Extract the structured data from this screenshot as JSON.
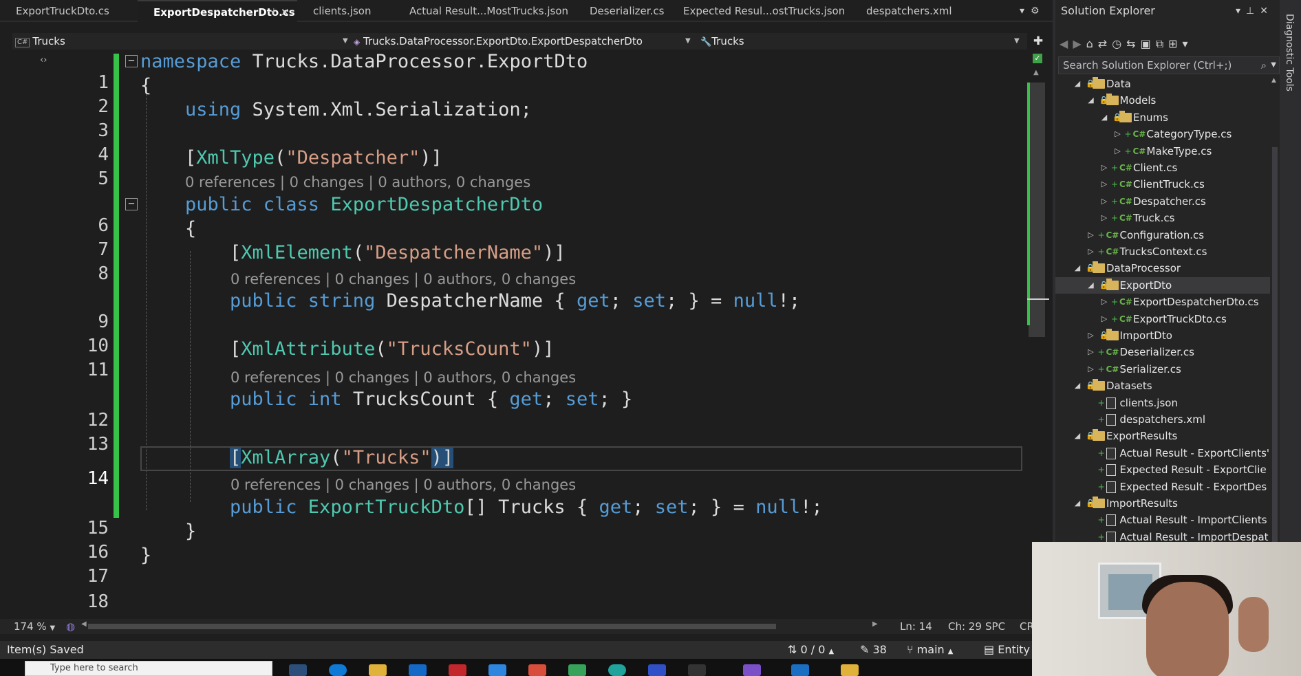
{
  "tabs": [
    {
      "label": "ExportTruckDto.cs",
      "active": false
    },
    {
      "label": "ExportDespatcherDto.cs",
      "active": true
    },
    {
      "label": "clients.json",
      "active": false
    },
    {
      "label": "Actual Result...MostTrucks.json",
      "active": false
    },
    {
      "label": "Deserializer.cs",
      "active": false
    },
    {
      "label": "Expected Resul...ostTrucks.json",
      "active": false
    },
    {
      "label": "despatchers.xml",
      "active": false
    }
  ],
  "navbar": {
    "project": "Trucks",
    "type": "Trucks.DataProcessor.ExportDto.ExportDespatcherDto",
    "member": "Trucks"
  },
  "editor": {
    "line_numbers": [
      "1",
      "2",
      "3",
      "4",
      "5",
      "6",
      "7",
      "8",
      "9",
      "10",
      "11",
      "12",
      "13",
      "14",
      "15",
      "16",
      "17",
      "18"
    ],
    "current_line": "14",
    "codelens": "0 references | 0 changes | 0 authors, 0 changes",
    "code": {
      "l1_kw": "namespace",
      "l1_name": " Trucks.DataProcessor.ExportDto",
      "l2": "{",
      "l3_kw": "using",
      "l3_rest": " System.Xml.Serialization;",
      "l5_open": "[",
      "l5_attr": "XmlType",
      "l5_p1": "(",
      "l5_str": "\"Despatcher\"",
      "l5_close": ")]",
      "l6_kw": "public class",
      "l6_type": " ExportDespatcherDto",
      "l7": "{",
      "l8_open": "[",
      "l8_attr": "XmlElement",
      "l8_p1": "(",
      "l8_str": "\"DespatcherName\"",
      "l8_close": ")]",
      "l9_kw": "public string",
      "l9_name": " DespatcherName { ",
      "l9_get": "get",
      "l9_s1": "; ",
      "l9_set": "set",
      "l9_s2": "; } = ",
      "l9_null": "null",
      "l9_end": "!;",
      "l11_open": "[",
      "l11_attr": "XmlAttribute",
      "l11_p1": "(",
      "l11_str": "\"TrucksCount\"",
      "l11_close": ")]",
      "l12_kw": "public int",
      "l12_name": " TrucksCount { ",
      "l12_get": "get",
      "l12_s1": "; ",
      "l12_set": "set",
      "l12_end": "; }",
      "l14_open": "[",
      "l14_attr": "XmlArray",
      "l14_p1": "(",
      "l14_str": "\"Trucks\"",
      "l14_close": ")]",
      "l15_kw": "public",
      "l15_type": " ExportTruckDto",
      "l15_mid": "[] Trucks { ",
      "l15_get": "get",
      "l15_s1": "; ",
      "l15_set": "set",
      "l15_s2": "; } = ",
      "l15_null": "null",
      "l15_end": "!;",
      "l16": "}",
      "l17": "}"
    }
  },
  "editor_status": {
    "zoom": "174 %",
    "line": "Ln: 14",
    "col": "Ch: 29",
    "whitespace": "SPC",
    "eol": "CR"
  },
  "statusbar": {
    "message": "Item(s) Saved",
    "sync": "0 / 0",
    "changes": "38",
    "branch": "main",
    "repo": "Entity"
  },
  "taskbar": {
    "search_placeholder": "Type here to search"
  },
  "solution_explorer": {
    "title": "Solution Explorer",
    "search_placeholder": "Search Solution Explorer (Ctrl+;)",
    "side_tab": "Diagnostic Tools",
    "nodes": [
      {
        "label": "Data",
        "kind": "folder",
        "depth": 0,
        "expanded": true
      },
      {
        "label": "Models",
        "kind": "folder",
        "depth": 1,
        "expanded": true
      },
      {
        "label": "Enums",
        "kind": "folder",
        "depth": 2,
        "expanded": true
      },
      {
        "label": "CategoryType.cs",
        "kind": "cs",
        "depth": 3,
        "expanded": false
      },
      {
        "label": "MakeType.cs",
        "kind": "cs",
        "depth": 3,
        "expanded": false
      },
      {
        "label": "Client.cs",
        "kind": "cs",
        "depth": 2,
        "expanded": false
      },
      {
        "label": "ClientTruck.cs",
        "kind": "cs",
        "depth": 2,
        "expanded": false
      },
      {
        "label": "Despatcher.cs",
        "kind": "cs",
        "depth": 2,
        "expanded": false
      },
      {
        "label": "Truck.cs",
        "kind": "cs",
        "depth": 2,
        "expanded": false
      },
      {
        "label": "Configuration.cs",
        "kind": "cs",
        "depth": 1,
        "expanded": false
      },
      {
        "label": "TrucksContext.cs",
        "kind": "cs",
        "depth": 1,
        "expanded": false
      },
      {
        "label": "DataProcessor",
        "kind": "folder",
        "depth": 0,
        "expanded": true
      },
      {
        "label": "ExportDto",
        "kind": "folder",
        "depth": 1,
        "expanded": true,
        "selected": true
      },
      {
        "label": "ExportDespatcherDto.cs",
        "kind": "cs",
        "depth": 2,
        "expanded": false
      },
      {
        "label": "ExportTruckDto.cs",
        "kind": "cs",
        "depth": 2,
        "expanded": false
      },
      {
        "label": "ImportDto",
        "kind": "folder",
        "depth": 1,
        "expanded": false
      },
      {
        "label": "Deserializer.cs",
        "kind": "cs",
        "depth": 1,
        "expanded": false
      },
      {
        "label": "Serializer.cs",
        "kind": "cs",
        "depth": 1,
        "expanded": false
      },
      {
        "label": "Datasets",
        "kind": "folder",
        "depth": 0,
        "expanded": true
      },
      {
        "label": "clients.json",
        "kind": "file",
        "depth": 1
      },
      {
        "label": "despatchers.xml",
        "kind": "file",
        "depth": 1
      },
      {
        "label": "ExportResults",
        "kind": "folder",
        "depth": 0,
        "expanded": true
      },
      {
        "label": "Actual Result - ExportClients'",
        "kind": "file",
        "depth": 1
      },
      {
        "label": "Expected Result - ExportClie",
        "kind": "file",
        "depth": 1
      },
      {
        "label": "Expected Result - ExportDes",
        "kind": "file",
        "depth": 1
      },
      {
        "label": "ImportResults",
        "kind": "folder",
        "depth": 0,
        "expanded": true
      },
      {
        "label": "Actual Result - ImportClients",
        "kind": "file",
        "depth": 1
      },
      {
        "label": "Actual Result - ImportDespat",
        "kind": "file",
        "depth": 1
      }
    ]
  }
}
